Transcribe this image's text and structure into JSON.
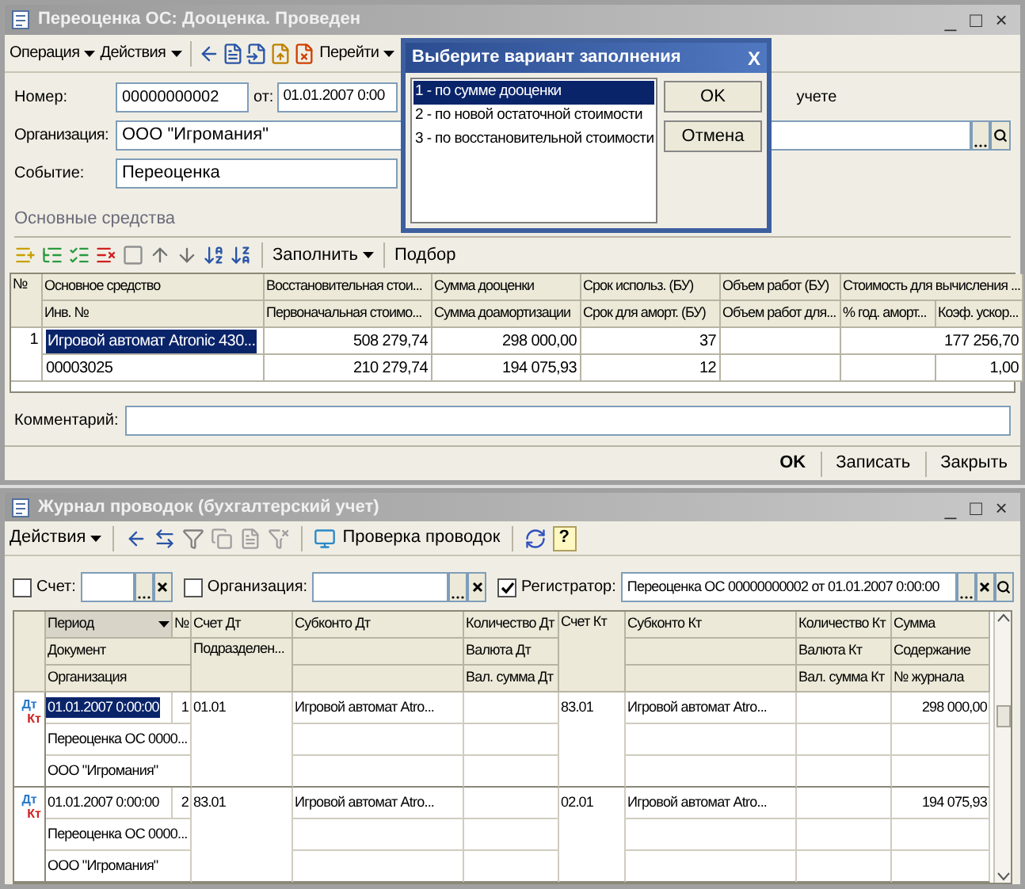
{
  "document_window": {
    "title": "Переоценка ОС: Дооценка. Проведен",
    "window_buttons": [
      "_",
      "□",
      "×"
    ],
    "toolbar": {
      "menus": [
        "Операция",
        "Действия"
      ],
      "goto": "Перейти"
    },
    "form": {
      "number_label": "Номер:",
      "number": "00000000002",
      "date_label": "от:",
      "date": "01.01.2007 0:00",
      "accounting_text": "учете",
      "organization_label": "Организация:",
      "organization": "ООО \"Игромания\"",
      "event_label": "Событие:",
      "event": "Переоценка"
    },
    "assets": {
      "title": "Основные средства",
      "fill": "Заполнить",
      "pick": "Подбор",
      "header_top": [
        "№",
        "Основное средство",
        "Восстановительная стои...",
        "Сумма дооценки",
        "Срок использ. (БУ)",
        "Объем работ (БУ)",
        "Стоимость для вычисления ..."
      ],
      "header_bottom": [
        "Инв. №",
        "Первоначальная стоимо...",
        "Сумма доамортизации",
        "Срок для аморт. (БУ)",
        "Объем работ для...",
        "% год. аморт...",
        "Коэф. ускор..."
      ],
      "rows": [
        {
          "number": "1",
          "asset": "Игровой автомат Atronic 430...",
          "asset_selected": true,
          "restoration_cost": "508 279,74",
          "revaluation_sum": "298 000,00",
          "useful_life": "37",
          "depreciation_base": "177 256,70",
          "inventory_no": "00003025",
          "initial_cost": "210 279,74",
          "extra_depreciation": "194 075,93",
          "depreciation_term": "12",
          "acceleration_factor": "1,00"
        }
      ]
    },
    "comment_label": "Комментарий:",
    "buttons": [
      {
        "label": "OK",
        "default": true
      },
      {
        "label": "Записать",
        "default": false
      },
      {
        "label": "Закрыть",
        "default": false
      }
    ]
  },
  "dialog": {
    "title": "Выберите вариант заполнения",
    "close": "X",
    "options": [
      {
        "label": "1 - по сумме дооценки",
        "selected": true
      },
      {
        "label": "2 - по новой остаточной стоимости",
        "selected": false
      },
      {
        "label": "3 - по восстановительной стоимости",
        "selected": false
      }
    ],
    "buttons": [
      "OK",
      "Отмена"
    ]
  },
  "journal_window": {
    "title": "Журнал проводок (бухгалтерский учет)",
    "window_buttons": [
      "_",
      "□",
      "×"
    ],
    "toolbar": {
      "actions": "Действия",
      "check": "Проверка проводок",
      "help": "?"
    },
    "filters": [
      {
        "label": "Счет:",
        "checked": false
      },
      {
        "label": "Организация:",
        "checked": false
      },
      {
        "label": "Регистратор:",
        "checked": true,
        "value": "Переоценка ОС 00000000002 от 01.01.2007 0:00:00"
      }
    ],
    "headers": {
      "period": "Период",
      "number": "№",
      "document": "Документ",
      "organization": "Организация",
      "debit_account": "Счет Дт",
      "subdivision": "Подразделен...",
      "debit_subconto": "Субконто Дт",
      "debit_quantity": "Количество Дт",
      "debit_currency": "Валюта Дт",
      "debit_currency_sum": "Вал. сумма Дт",
      "credit_account": "Счет Кт",
      "credit_subconto": "Субконто Кт",
      "credit_quantity": "Количество Кт",
      "credit_currency": "Валюта Кт",
      "credit_currency_sum": "Вал. сумма Кт",
      "amount": "Сумма",
      "content": "Содержание",
      "journal_no": "№ журнала"
    },
    "entries": [
      {
        "debit_mark": "Дт",
        "credit_mark": "Кт",
        "period": "01.01.2007 0:00:00",
        "period_selected": true,
        "number": "1",
        "document": "Переоценка ОС 0000...",
        "organization": "ООО \"Игромания\"",
        "debit_account": "01.01",
        "debit_subconto": "Игровой автомат Atro...",
        "credit_account": "83.01",
        "credit_subconto": "Игровой автомат Atro...",
        "amount": "298 000,00"
      },
      {
        "debit_mark": "Дт",
        "credit_mark": "Кт",
        "period": "01.01.2007 0:00:00",
        "period_selected": false,
        "number": "2",
        "document": "Переоценка ОС 0000...",
        "organization": "ООО \"Игромания\"",
        "debit_account": "83.01",
        "debit_subconto": "Игровой автомат Atro...",
        "credit_account": "02.01",
        "credit_subconto": "Игровой автомат Atro...",
        "amount": "194 075,93"
      }
    ]
  }
}
